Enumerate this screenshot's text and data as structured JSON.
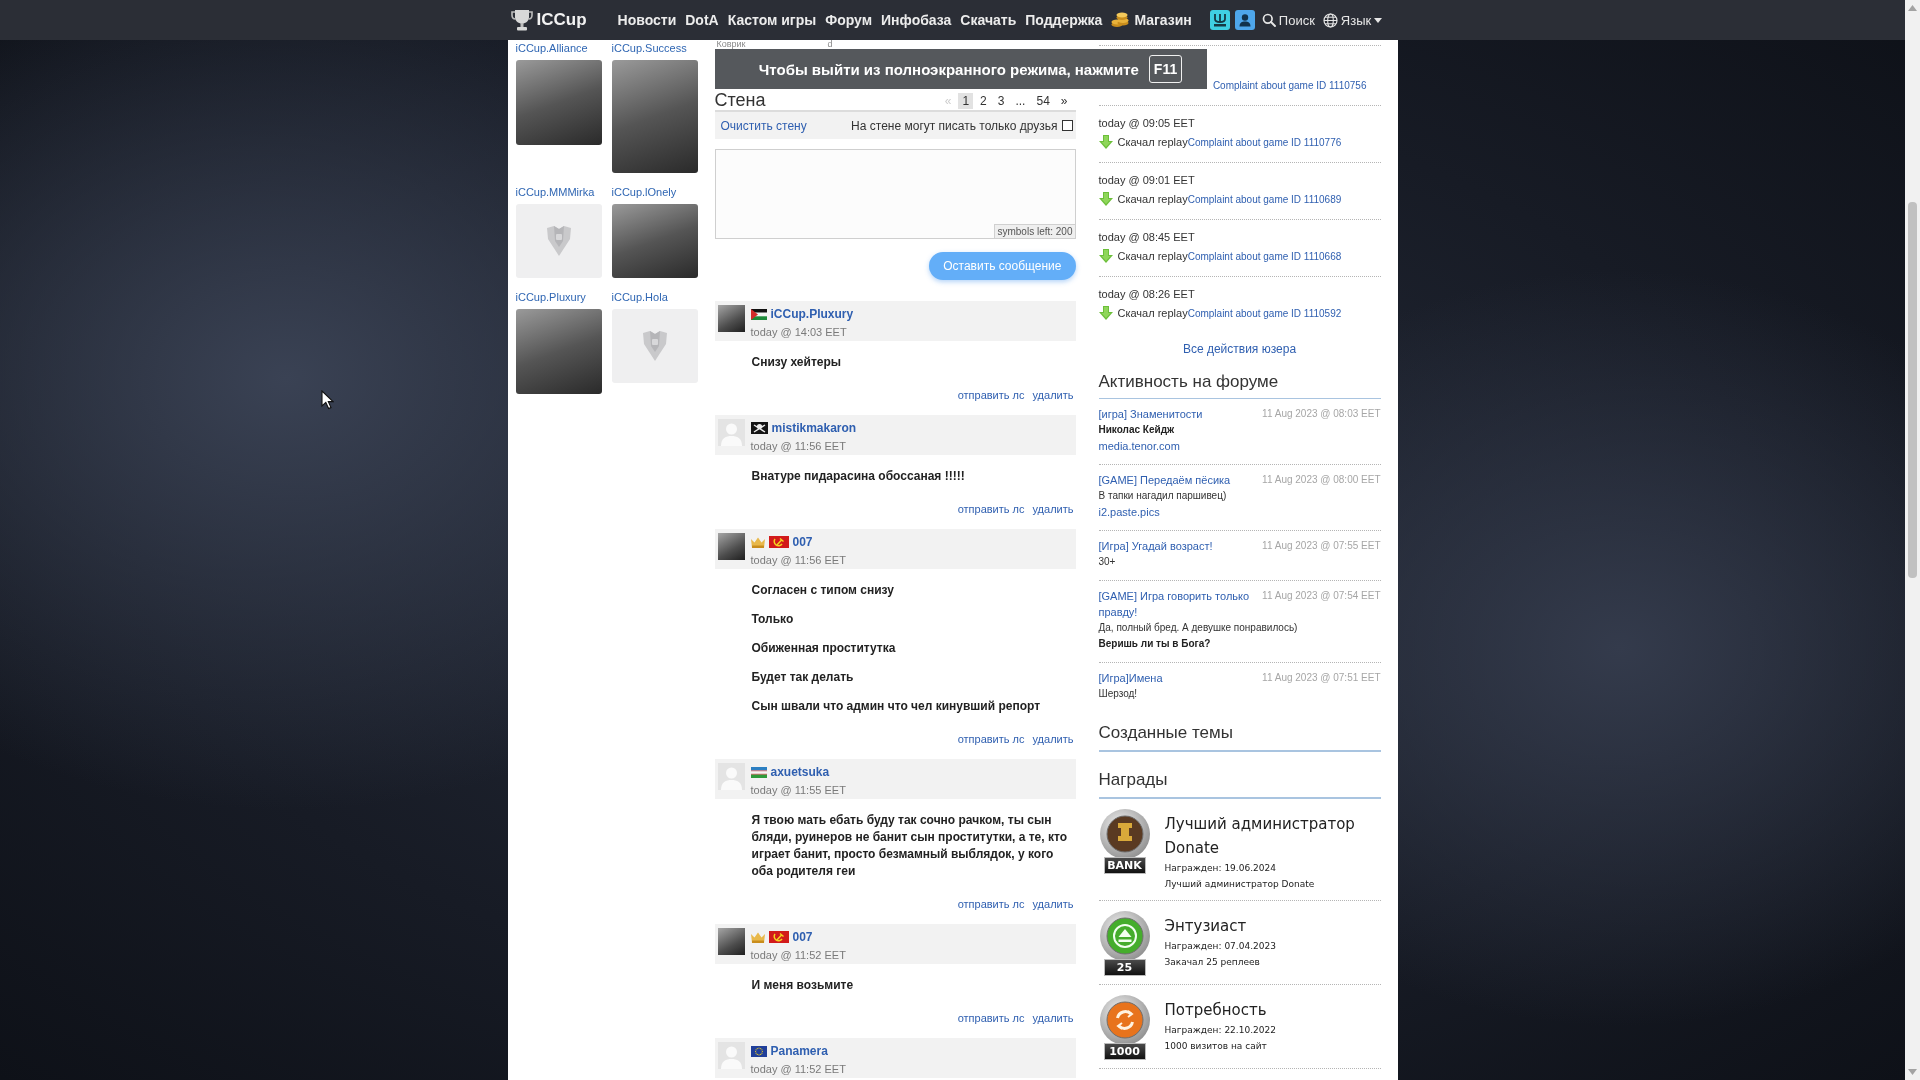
{
  "nav": {
    "logo": "ICCup",
    "links": [
      "Новости",
      "DotA",
      "Кастом игры",
      "Форум",
      "Инфобаза",
      "Скачать",
      "Поддержка"
    ],
    "shop": "Магазин",
    "search": "Поиск",
    "language": "Язык"
  },
  "fullscreen_notice": {
    "text": "Чтобы выйти из полноэкранного режима, нажмите",
    "key": "F11"
  },
  "friends": [
    {
      "name": "iCCup.Alliance",
      "kind": "square-photo"
    },
    {
      "name": "iCCup.Success",
      "kind": "portrait-photo"
    },
    {
      "name": "iCCup.MMMirka",
      "kind": "default"
    },
    {
      "name": "iCCup.lOnely",
      "kind": "landscape-photo"
    },
    {
      "name": "iCCup.Pluxury",
      "kind": "square-photo"
    },
    {
      "name": "iCCup.Hola",
      "kind": "default"
    }
  ],
  "wall": {
    "labels": [
      "Коврик",
      "d"
    ],
    "title": "Стена",
    "pagination": [
      {
        "label": "«",
        "selected": false,
        "disabled": true
      },
      {
        "label": "1",
        "selected": true,
        "disabled": false
      },
      {
        "label": "2",
        "selected": false,
        "disabled": false
      },
      {
        "label": "3",
        "selected": false,
        "disabled": false
      },
      {
        "label": "...",
        "selected": false,
        "disabled": false
      },
      {
        "label": "54",
        "selected": false,
        "disabled": false
      },
      {
        "label": "»",
        "selected": false,
        "disabled": false
      }
    ],
    "clear_link": "Очистить стену",
    "friends_only": {
      "label": "На стене могут писать только друзья",
      "checked": false
    },
    "counter": "symbols left: 200",
    "submit": "Оставить сообщение",
    "posts": [
      {
        "author": "iCCup.Pluxury",
        "avatar": {
          "kind": "photo"
        },
        "icons": [
          {
            "kind": "flag-stripes"
          }
        ],
        "time": "today @ 14:03 EET",
        "message": [
          "Снизу хейтеры"
        ],
        "actions": [
          "отправить лс",
          "удалить"
        ]
      },
      {
        "author": "mistikmakaron",
        "avatar": {
          "kind": "default"
        },
        "icons": [
          {
            "kind": "flag-pirate"
          }
        ],
        "time": "today @ 11:56 EET",
        "message": [
          "Внатуре пидарасина обоссаная !!!!!"
        ],
        "actions": [
          "отправить лс",
          "удалить"
        ]
      },
      {
        "author": "007",
        "avatar": {
          "kind": "photo"
        },
        "icons": [
          {
            "kind": "crown"
          },
          {
            "kind": "flag-hammer"
          }
        ],
        "time": "today @ 11:56 EET",
        "message": [
          "Согласен с типом снизу",
          "Только",
          "Обиженная проститутка",
          "Будет так делать",
          "Сын швали что админ что чел кинувший репорт"
        ],
        "actions": [
          "отправить лс",
          "удалить"
        ]
      },
      {
        "author": "axuetsuka",
        "avatar": {
          "kind": "default"
        },
        "icons": [
          {
            "kind": "flag-tricolor"
          }
        ],
        "time": "today @ 11:55 EET",
        "message": [
          "Я твою мать ебать буду так сочно рачком, ты сын бляди, руинеров не банит сын проститутки, а те, кто играет банит, просто безмамный выблядок, у кого оба родителя геи"
        ],
        "actions": [
          "отправить лс",
          "удалить"
        ]
      },
      {
        "author": "007",
        "avatar": {
          "kind": "photo"
        },
        "icons": [
          {
            "kind": "crown"
          },
          {
            "kind": "flag-hammer"
          }
        ],
        "time": "today @ 11:52 EET",
        "message": [
          "И меня возьмите"
        ],
        "actions": [
          "отправить лс",
          "удалить"
        ]
      },
      {
        "author": "Panamera",
        "avatar": {
          "kind": "default"
        },
        "icons": [
          {
            "kind": "flag-stars"
          }
        ],
        "time": "today @ 11:52 EET"
      }
    ]
  },
  "activity": {
    "entries": [
      {
        "link": "Complaint about game ID 1110756"
      },
      {
        "time": "today @ 09:05 EET",
        "action": "Скачал replay",
        "link": "Complaint about game ID 1110776"
      },
      {
        "time": "today @ 09:01 EET",
        "action": "Скачал replay",
        "link": "Complaint about game ID 1110689"
      },
      {
        "time": "today @ 08:45 EET",
        "action": "Скачал replay",
        "link": "Complaint about game ID 1110668"
      },
      {
        "time": "today @ 08:26 EET",
        "action": "Скачал replay",
        "link": "Complaint about game ID 1110592"
      }
    ],
    "all_link": "Все действия юзера"
  },
  "forum": {
    "title": "Активность на форуме",
    "items": [
      {
        "topic": "[игра] Знаменитости",
        "date": "11 Aug 2023 @ 08:03 EET",
        "lines": [
          {
            "text": "Николас Кейдж",
            "kind": "bold"
          },
          {
            "text": "media.tenor.com",
            "kind": "link"
          }
        ]
      },
      {
        "topic": "[GAME] Передаём пёсика",
        "date": "11 Aug 2023 @ 08:00 EET",
        "lines": [
          {
            "text": "В тапки нагадил паршивец)",
            "kind": "plain"
          },
          {
            "text": "i2.paste.pics",
            "kind": "link"
          }
        ]
      },
      {
        "topic": "[Игра] Угадай возраст!",
        "date": "11 Aug 2023 @ 07:55 EET",
        "lines": [
          {
            "text": "30+",
            "kind": "plain"
          }
        ]
      },
      {
        "topic": "[GAME] Игра говорить только правду!",
        "date": "11 Aug 2023 @ 07:54 EET",
        "lines": [
          {
            "text": "Да, полный бред. А девушке понравилось)",
            "kind": "plain"
          },
          {
            "text": "Веришь ли ты в Бога?",
            "kind": "bold"
          }
        ]
      },
      {
        "topic": "[Игра]Имена",
        "date": "11 Aug 2023 @ 07:51 EET",
        "lines": [
          {
            "text": "Шерзод!",
            "kind": "plain"
          }
        ]
      }
    ]
  },
  "created_topics": {
    "title": "Созданные темы"
  },
  "awards": {
    "title": "Награды",
    "items": [
      {
        "name": "Лучший администратор Donate",
        "kind": "rook",
        "plate": "BANK",
        "date": "Награжден: 19.06.2024",
        "description": "Лучший администратор Donate"
      },
      {
        "name": "Энтузиаст",
        "kind": "eject",
        "plate": "25",
        "date": "Награжден: 07.04.2023",
        "description": "Закачал 25 реплеев"
      },
      {
        "name": "Потребность",
        "kind": "cycle",
        "plate": "1000",
        "date": "Награжден: 22.10.2022",
        "description": "1000 визитов на сайт"
      }
    ]
  }
}
